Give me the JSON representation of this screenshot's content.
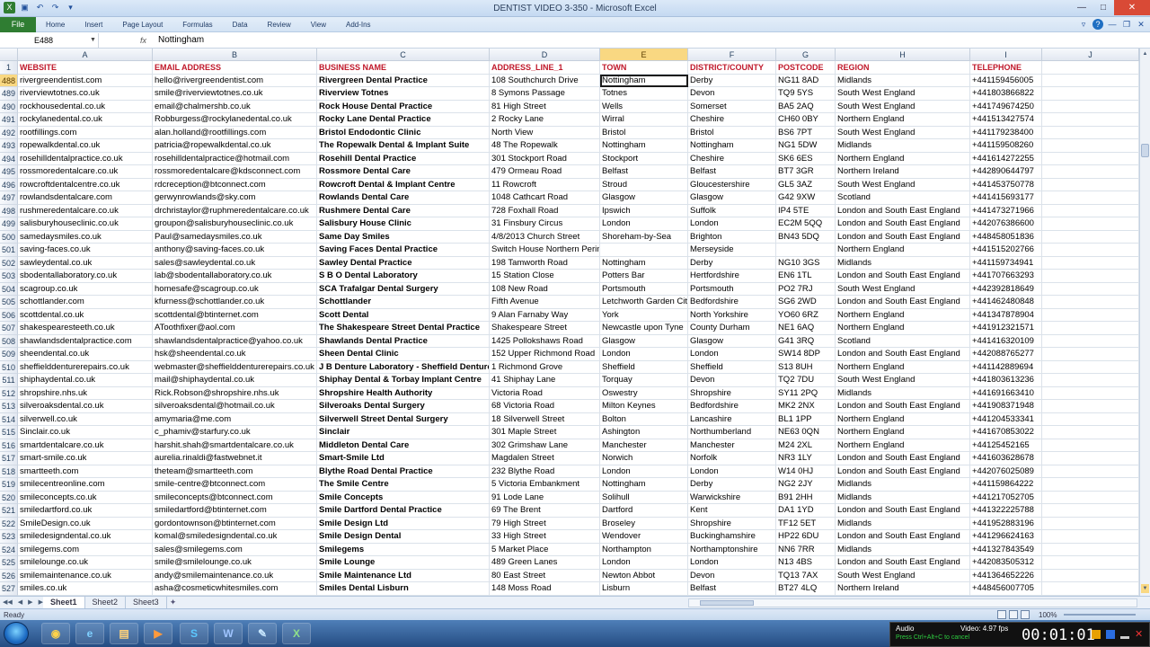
{
  "window": {
    "title": "DENTIST VIDEO 3-350  -  Microsoft Excel"
  },
  "ribbon": {
    "file_tab": "File",
    "tabs": [
      "Home",
      "Insert",
      "Page Layout",
      "Formulas",
      "Data",
      "Review",
      "View",
      "Add-Ins"
    ]
  },
  "formula_bar": {
    "name_box": "E488",
    "fx": "fx",
    "content": "Nottingham"
  },
  "colors": {
    "header_text": "#c0182a",
    "selected_header": "#f9d882",
    "file_tab": "#2f7d32"
  },
  "columns": [
    "A",
    "B",
    "C",
    "D",
    "E",
    "F",
    "G",
    "H",
    "I",
    "J"
  ],
  "header_row": {
    "row_number": "1",
    "cells": [
      "WEBSITE",
      "EMAIL ADDRESS",
      "BUSINESS NAME",
      "ADDRESS_LINE_1",
      "TOWN",
      "DISTRICT/COUNTY",
      "POSTCODE",
      "REGION",
      "TELEPHONE",
      ""
    ]
  },
  "rows": [
    {
      "n": "488",
      "c": [
        "rivergreendentist.com",
        "hello@rivergreendentist.com",
        "Rivergreen Dental Practice",
        "108  Southchurch Drive",
        "Nottingham",
        "Derby",
        "NG11 8AD",
        "Midlands",
        "+441159456005",
        ""
      ]
    },
    {
      "n": "489",
      "c": [
        "riverviewtotnes.co.uk",
        "smile@riverviewtotnes.co.uk",
        "Riverview Totnes",
        "8  Symons Passage",
        "Totnes",
        "Devon",
        "TQ9 5YS",
        "South West England",
        "+441803866822",
        ""
      ]
    },
    {
      "n": "490",
      "c": [
        "rockhousedental.co.uk",
        "email@chalmershb.co.uk",
        "Rock House Dental Practice",
        "81  High Street",
        "Wells",
        "Somerset",
        "BA5 2AQ",
        "South West England",
        "+441749674250",
        ""
      ]
    },
    {
      "n": "491",
      "c": [
        "rockylanedental.co.uk",
        "Robburgess@rockylanedental.co.uk",
        "Rocky Lane Dental Practice",
        "2  Rocky Lane",
        "Wirral",
        "Cheshire",
        "CH60 0BY",
        "Northern England",
        "+441513427574",
        ""
      ]
    },
    {
      "n": "492",
      "c": [
        "rootfillings.com",
        "alan.holland@rootfillings.com",
        "Bristol Endodontic Clinic",
        "North View",
        "Bristol",
        "Bristol",
        "BS6 7PT",
        "South West England",
        "+441179238400",
        ""
      ]
    },
    {
      "n": "493",
      "c": [
        "ropewalkdental.co.uk",
        "patricia@ropewalkdental.co.uk",
        "The Ropewalk Dental & Implant Suite",
        "48  The Ropewalk",
        "Nottingham",
        "Nottingham",
        "NG1 5DW",
        "Midlands",
        "+441159508260",
        ""
      ]
    },
    {
      "n": "494",
      "c": [
        "rosehilldentalpractice.co.uk",
        "rosehilldentalpractice@hotmail.com",
        "Rosehill Dental Practice",
        "301  Stockport Road",
        "Stockport",
        "Cheshire",
        "SK6 6ES",
        "Northern England",
        "+441614272255",
        ""
      ]
    },
    {
      "n": "495",
      "c": [
        "rossmoredentalcare.co.uk",
        "rossmoredentalcare@kdsconnect.com",
        "Rossmore Dental Care",
        "479  Ormeau Road",
        "Belfast",
        "Belfast",
        "BT7 3GR",
        "Northern Ireland",
        "+442890644797",
        ""
      ]
    },
    {
      "n": "496",
      "c": [
        "rowcroftdentalcentre.co.uk",
        "rdcreception@btconnect.com",
        "Rowcroft Dental & Implant Centre",
        "11  Rowcroft",
        "Stroud",
        "Gloucestershire",
        "GL5 3AZ",
        "South West England",
        "+441453750778",
        ""
      ]
    },
    {
      "n": "497",
      "c": [
        "rowlandsdentalcare.com",
        "gerwynrowlands@sky.com",
        "Rowlands Dental Care",
        "1048  Cathcart Road",
        "Glasgow",
        "Glasgow",
        "G42 9XW",
        "Scotland",
        "+441415693177",
        ""
      ]
    },
    {
      "n": "498",
      "c": [
        "rushmeredentalcare.co.uk",
        "drchristaylor@ruphmeredentalcare.co.uk",
        "Rushmere Dental Care",
        "728  Foxhall Road",
        "Ipswich",
        "Suffolk",
        "IP4 5TE",
        "London and South East England",
        "+441473271966",
        ""
      ]
    },
    {
      "n": "499",
      "c": [
        "salisburyhouseclinic.co.uk",
        "groupon@salisburyhouseclinic.co.uk",
        "Salisbury House Clinic",
        "31  Finsbury Circus",
        "London",
        "London",
        "EC2M 5QQ",
        "London and South East England",
        "+442076386600",
        ""
      ]
    },
    {
      "n": "500",
      "c": [
        "samedaysmiles.co.uk",
        "Paul@samedaysmiles.co.uk",
        "Same Day Smiles",
        "4/8/2013  Church Street",
        "Shoreham-by-Sea",
        "Brighton",
        "BN43 5DQ",
        "London and South East England",
        "+448458051836",
        ""
      ]
    },
    {
      "n": "501",
      "c": [
        "saving-faces.co.uk",
        "anthony@saving-faces.co.uk",
        "Saving Faces Dental Practice",
        "Switch House Northern Perimeter Road Liverpool",
        "",
        "Merseyside",
        "",
        "Northern England",
        "+441515202766",
        ""
      ]
    },
    {
      "n": "502",
      "c": [
        "sawleydental.co.uk",
        "sales@sawleydental.co.uk",
        "Sawley Dental Practice",
        "198  Tamworth Road",
        "Nottingham",
        "Derby",
        "NG10 3GS",
        "Midlands",
        "+441159734941",
        ""
      ]
    },
    {
      "n": "503",
      "c": [
        "sbodentallaboratory.co.uk",
        "lab@sbodentallaboratory.co.uk",
        "S B O Dental Laboratory",
        "15  Station Close",
        "Potters Bar",
        "Hertfordshire",
        "EN6 1TL",
        "London and South East England",
        "+441707663293",
        ""
      ]
    },
    {
      "n": "504",
      "c": [
        "scagroup.co.uk",
        "homesafe@scagroup.co.uk",
        "SCA Trafalgar Dental Surgery",
        "108  New Road",
        "Portsmouth",
        "Portsmouth",
        "PO2 7RJ",
        "South West England",
        "+442392818649",
        ""
      ]
    },
    {
      "n": "505",
      "c": [
        "schottlander.com",
        "kfurness@schottlander.co.uk",
        "Schottlander",
        "Fifth Avenue",
        "Letchworth Garden City",
        "Bedfordshire",
        "SG6 2WD",
        "London and South East England",
        "+441462480848",
        ""
      ]
    },
    {
      "n": "506",
      "c": [
        "scottdental.co.uk",
        "scottdental@btinternet.com",
        "Scott Dental",
        "9  Alan Farnaby Way",
        "York",
        "North Yorkshire",
        "YO60 6RZ",
        "Northern England",
        "+441347878904",
        ""
      ]
    },
    {
      "n": "507",
      "c": [
        "shakespearesteeth.co.uk",
        "AToothfixer@aol.com",
        "The Shakespeare Street Dental Practice",
        "Shakespeare Street",
        "Newcastle upon Tyne",
        "County Durham",
        "NE1 6AQ",
        "Northern England",
        "+441912321571",
        ""
      ]
    },
    {
      "n": "508",
      "c": [
        "shawlandsdentalpractice.com",
        "shawlandsdentalpractice@yahoo.co.uk",
        "Shawlands Dental Practice",
        "1425  Pollokshaws Road",
        "Glasgow",
        "Glasgow",
        "G41 3RQ",
        "Scotland",
        "+441416320109",
        ""
      ]
    },
    {
      "n": "509",
      "c": [
        "sheendental.co.uk",
        "hsk@sheendental.co.uk",
        "Sheen Dental Clinic",
        "152  Upper Richmond Road",
        "London",
        "London",
        "SW14 8DP",
        "London and South East England",
        "+442088765277",
        ""
      ]
    },
    {
      "n": "510",
      "c": [
        "sheffielddenturerepairs.co.uk",
        "webmaster@sheffielddenturerepairs.co.uk",
        "J B Denture Laboratory - Sheffield Denture",
        "1  Richmond Grove",
        "Sheffield",
        "Sheffield",
        "S13 8UH",
        "Northern England",
        "+441142889694",
        ""
      ]
    },
    {
      "n": "511",
      "c": [
        "shiphaydental.co.uk",
        "mail@shiphaydental.co.uk",
        "Shiphay Dental & Torbay Implant Centre",
        "41  Shiphay Lane",
        "Torquay",
        "Devon",
        "TQ2 7DU",
        "South West England",
        "+441803613236",
        ""
      ]
    },
    {
      "n": "512",
      "c": [
        "shropshire.nhs.uk",
        "Rick.Robson@shropshire.nhs.uk",
        "Shropshire Health Authority",
        "Victoria Road",
        "Oswestry",
        "Shropshire",
        "SY11 2PQ",
        "Midlands",
        "+441691663410",
        ""
      ]
    },
    {
      "n": "513",
      "c": [
        "silveroaksdental.co.uk",
        "silveroaksdental@hotmail.co.uk",
        "Silveroaks Dental Surgery",
        "68  Victoria Road",
        "Milton Keynes",
        "Bedfordshire",
        "MK2 2NX",
        "London and South East England",
        "+441908371948",
        ""
      ]
    },
    {
      "n": "514",
      "c": [
        "silverwell.co.uk",
        "amymaria@me.com",
        "Silverwell Street Dental Surgery",
        "18  Silverwell Street",
        "Bolton",
        "Lancashire",
        "BL1 1PP",
        "Northern England",
        "+441204533341",
        ""
      ]
    },
    {
      "n": "515",
      "c": [
        "Sinclair.co.uk",
        "c_phamiv@starfury.co.uk",
        "Sinclair",
        "301  Maple Street",
        "Ashington",
        "Northumberland",
        "NE63 0QN",
        "Northern England",
        "+441670853022",
        ""
      ]
    },
    {
      "n": "516",
      "c": [
        "smartdentalcare.co.uk",
        "harshit.shah@smartdentalcare.co.uk",
        "Middleton Dental Care",
        "302  Grimshaw Lane",
        "Manchester",
        "Manchester",
        "M24 2XL",
        "Northern England",
        "+44125452165",
        ""
      ]
    },
    {
      "n": "517",
      "c": [
        "smart-smile.co.uk",
        "aurelia.rinaldi@fastwebnet.it",
        "Smart-Smile Ltd",
        "Magdalen Street",
        "Norwich",
        "Norfolk",
        "NR3 1LY",
        "London and South East England",
        "+441603628678",
        ""
      ]
    },
    {
      "n": "518",
      "c": [
        "smartteeth.com",
        "theteam@smartteeth.com",
        "Blythe Road Dental Practice",
        "232  Blythe Road",
        "London",
        "London",
        "W14 0HJ",
        "London and South East England",
        "+442076025089",
        ""
      ]
    },
    {
      "n": "519",
      "c": [
        "smilecentreonline.com",
        "smile-centre@btconnect.com",
        "The Smile Centre",
        "5  Victoria Embankment",
        "Nottingham",
        "Derby",
        "NG2 2JY",
        "Midlands",
        "+441159864222",
        ""
      ]
    },
    {
      "n": "520",
      "c": [
        "smileconcepts.co.uk",
        "smileconcepts@btconnect.com",
        "Smile Concepts",
        "91  Lode Lane",
        "Solihull",
        "Warwickshire",
        "B91 2HH",
        "Midlands",
        "+441217052705",
        ""
      ]
    },
    {
      "n": "521",
      "c": [
        "smiledartford.co.uk",
        "smiledartford@btinternet.com",
        "Smile Dartford Dental Practice",
        "69  The Brent",
        "Dartford",
        "Kent",
        "DA1 1YD",
        "London and South East England",
        "+441322225788",
        ""
      ]
    },
    {
      "n": "522",
      "c": [
        "SmileDesign.co.uk",
        "gordontownson@btinternet.com",
        "Smile Design Ltd",
        "79  High Street",
        "Broseley",
        "Shropshire",
        "TF12 5ET",
        "Midlands",
        "+441952883196",
        ""
      ]
    },
    {
      "n": "523",
      "c": [
        "smiledesigndental.co.uk",
        "komal@smiledesigndental.co.uk",
        "Smile Design Dental",
        "33  High Street",
        "Wendover",
        "Buckinghamshire",
        "HP22 6DU",
        "London and South East England",
        "+441296624163",
        ""
      ]
    },
    {
      "n": "524",
      "c": [
        "smilegems.com",
        "sales@smilegems.com",
        "Smilegems",
        "5  Market Place",
        "Northampton",
        "Northamptonshire",
        "NN6 7RR",
        "Midlands",
        "+441327843549",
        ""
      ]
    },
    {
      "n": "525",
      "c": [
        "smilelounge.co.uk",
        "smile@smilelounge.co.uk",
        "Smile Lounge",
        "489  Green Lanes",
        "London",
        "London",
        "N13 4BS",
        "London and South East England",
        "+442083505312",
        ""
      ]
    },
    {
      "n": "526",
      "c": [
        "smilemaintenance.co.uk",
        "andy@smilemaintenance.co.uk",
        "Smile Maintenance Ltd",
        "80  East Street",
        "Newton Abbot",
        "Devon",
        "TQ13 7AX",
        "South West England",
        "+441364652226",
        ""
      ]
    },
    {
      "n": "527",
      "c": [
        "smiles.co.uk",
        "asha@cosmeticwhitesmiles.com",
        "Smiles Dental Lisburn",
        "148  Moss Road",
        "Lisburn",
        "Belfast",
        "BT27 4LQ",
        "Northern Ireland",
        "+448456007705",
        ""
      ]
    }
  ],
  "sheets": [
    "Sheet1",
    "Sheet2",
    "Sheet3"
  ],
  "status_bar": {
    "status": "Ready",
    "zoom": "100%"
  },
  "recorder": {
    "audio": "Audio",
    "video": "Video: 4.97 fps",
    "hint": "Press Ctrl+Alt+C to cancel",
    "timer": "00:01:01"
  }
}
